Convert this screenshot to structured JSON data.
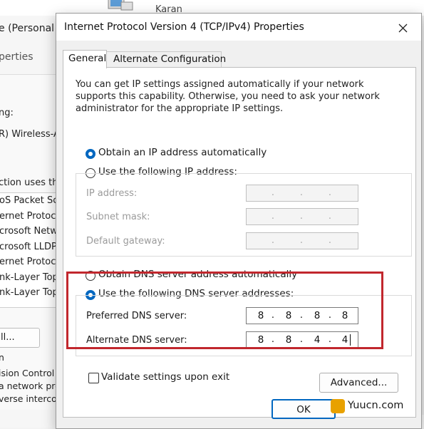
{
  "background_window": {
    "user_name": "Karan",
    "title_fragment": "e (Personal",
    "tab_fragment": "perties",
    "connect_label_fragment": "ng:",
    "adapter_fragment": "R) Wireless-A",
    "uses_fragment": "ction uses the",
    "list_items": [
      "oS Packet Sc",
      "ernet Protoco",
      "crosoft Netwo",
      "crosoft LLDP",
      "ernet Protoco",
      "nk-Layer Topo",
      "nk-Layer Topo"
    ],
    "button_fragment": "ll...",
    "desc_heading_fragment": "n",
    "desc_lines": [
      "ision Control F",
      "a network pro",
      "verse interco"
    ]
  },
  "dialog": {
    "title": "Internet Protocol Version 4 (TCP/IPv4) Properties",
    "tabs": [
      {
        "label": "General",
        "active": true
      },
      {
        "label": "Alternate Configuration",
        "active": false
      }
    ],
    "intro_text": "You can get IP settings assigned automatically if your network supports this capability. Otherwise, you need to ask your network administrator for the appropriate IP settings.",
    "ip_options": {
      "auto_label": "Obtain an IP address automatically",
      "manual_label": "Use the following IP address:",
      "selected": "auto"
    },
    "ip_fields": [
      {
        "label": "IP address:",
        "value": [
          "",
          "",
          "",
          ""
        ]
      },
      {
        "label": "Subnet mask:",
        "value": [
          "",
          "",
          "",
          ""
        ]
      },
      {
        "label": "Default gateway:",
        "value": [
          "",
          "",
          "",
          ""
        ]
      }
    ],
    "dns_options": {
      "auto_label": "Obtain DNS server address automatically",
      "manual_label": "Use the following DNS server addresses:",
      "selected": "manual"
    },
    "dns_fields": [
      {
        "label": "Preferred DNS server:",
        "value": [
          "8",
          "8",
          "8",
          "8"
        ]
      },
      {
        "label": "Alternate DNS server:",
        "value": [
          "8",
          "8",
          "4",
          "4"
        ]
      }
    ],
    "validate_label": "Validate settings upon exit",
    "validate_checked": false,
    "advanced_label": "Advanced...",
    "ok_label": "OK"
  },
  "watermark": {
    "text": "Yuucn.com"
  },
  "colors": {
    "accent": "#0067c0",
    "highlight": "#c1272d"
  }
}
